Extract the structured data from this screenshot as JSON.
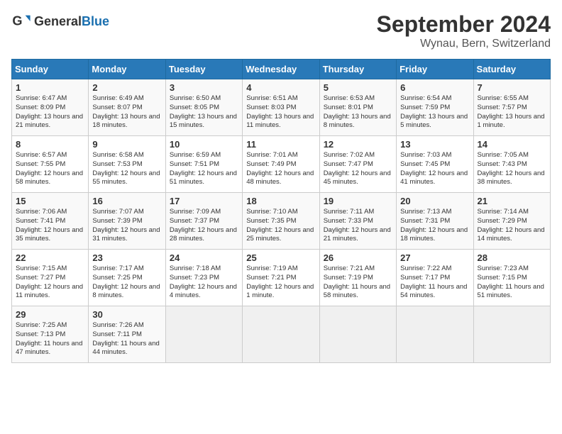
{
  "header": {
    "logo_general": "General",
    "logo_blue": "Blue",
    "title": "September 2024",
    "subtitle": "Wynau, Bern, Switzerland"
  },
  "days_of_week": [
    "Sunday",
    "Monday",
    "Tuesday",
    "Wednesday",
    "Thursday",
    "Friday",
    "Saturday"
  ],
  "weeks": [
    {
      "days": [
        {
          "num": "1",
          "sunrise": "Sunrise: 6:47 AM",
          "sunset": "Sunset: 8:09 PM",
          "daylight": "Daylight: 13 hours and 21 minutes."
        },
        {
          "num": "2",
          "sunrise": "Sunrise: 6:49 AM",
          "sunset": "Sunset: 8:07 PM",
          "daylight": "Daylight: 13 hours and 18 minutes."
        },
        {
          "num": "3",
          "sunrise": "Sunrise: 6:50 AM",
          "sunset": "Sunset: 8:05 PM",
          "daylight": "Daylight: 13 hours and 15 minutes."
        },
        {
          "num": "4",
          "sunrise": "Sunrise: 6:51 AM",
          "sunset": "Sunset: 8:03 PM",
          "daylight": "Daylight: 13 hours and 11 minutes."
        },
        {
          "num": "5",
          "sunrise": "Sunrise: 6:53 AM",
          "sunset": "Sunset: 8:01 PM",
          "daylight": "Daylight: 13 hours and 8 minutes."
        },
        {
          "num": "6",
          "sunrise": "Sunrise: 6:54 AM",
          "sunset": "Sunset: 7:59 PM",
          "daylight": "Daylight: 13 hours and 5 minutes."
        },
        {
          "num": "7",
          "sunrise": "Sunrise: 6:55 AM",
          "sunset": "Sunset: 7:57 PM",
          "daylight": "Daylight: 13 hours and 1 minute."
        }
      ]
    },
    {
      "days": [
        {
          "num": "8",
          "sunrise": "Sunrise: 6:57 AM",
          "sunset": "Sunset: 7:55 PM",
          "daylight": "Daylight: 12 hours and 58 minutes."
        },
        {
          "num": "9",
          "sunrise": "Sunrise: 6:58 AM",
          "sunset": "Sunset: 7:53 PM",
          "daylight": "Daylight: 12 hours and 55 minutes."
        },
        {
          "num": "10",
          "sunrise": "Sunrise: 6:59 AM",
          "sunset": "Sunset: 7:51 PM",
          "daylight": "Daylight: 12 hours and 51 minutes."
        },
        {
          "num": "11",
          "sunrise": "Sunrise: 7:01 AM",
          "sunset": "Sunset: 7:49 PM",
          "daylight": "Daylight: 12 hours and 48 minutes."
        },
        {
          "num": "12",
          "sunrise": "Sunrise: 7:02 AM",
          "sunset": "Sunset: 7:47 PM",
          "daylight": "Daylight: 12 hours and 45 minutes."
        },
        {
          "num": "13",
          "sunrise": "Sunrise: 7:03 AM",
          "sunset": "Sunset: 7:45 PM",
          "daylight": "Daylight: 12 hours and 41 minutes."
        },
        {
          "num": "14",
          "sunrise": "Sunrise: 7:05 AM",
          "sunset": "Sunset: 7:43 PM",
          "daylight": "Daylight: 12 hours and 38 minutes."
        }
      ]
    },
    {
      "days": [
        {
          "num": "15",
          "sunrise": "Sunrise: 7:06 AM",
          "sunset": "Sunset: 7:41 PM",
          "daylight": "Daylight: 12 hours and 35 minutes."
        },
        {
          "num": "16",
          "sunrise": "Sunrise: 7:07 AM",
          "sunset": "Sunset: 7:39 PM",
          "daylight": "Daylight: 12 hours and 31 minutes."
        },
        {
          "num": "17",
          "sunrise": "Sunrise: 7:09 AM",
          "sunset": "Sunset: 7:37 PM",
          "daylight": "Daylight: 12 hours and 28 minutes."
        },
        {
          "num": "18",
          "sunrise": "Sunrise: 7:10 AM",
          "sunset": "Sunset: 7:35 PM",
          "daylight": "Daylight: 12 hours and 25 minutes."
        },
        {
          "num": "19",
          "sunrise": "Sunrise: 7:11 AM",
          "sunset": "Sunset: 7:33 PM",
          "daylight": "Daylight: 12 hours and 21 minutes."
        },
        {
          "num": "20",
          "sunrise": "Sunrise: 7:13 AM",
          "sunset": "Sunset: 7:31 PM",
          "daylight": "Daylight: 12 hours and 18 minutes."
        },
        {
          "num": "21",
          "sunrise": "Sunrise: 7:14 AM",
          "sunset": "Sunset: 7:29 PM",
          "daylight": "Daylight: 12 hours and 14 minutes."
        }
      ]
    },
    {
      "days": [
        {
          "num": "22",
          "sunrise": "Sunrise: 7:15 AM",
          "sunset": "Sunset: 7:27 PM",
          "daylight": "Daylight: 12 hours and 11 minutes."
        },
        {
          "num": "23",
          "sunrise": "Sunrise: 7:17 AM",
          "sunset": "Sunset: 7:25 PM",
          "daylight": "Daylight: 12 hours and 8 minutes."
        },
        {
          "num": "24",
          "sunrise": "Sunrise: 7:18 AM",
          "sunset": "Sunset: 7:23 PM",
          "daylight": "Daylight: 12 hours and 4 minutes."
        },
        {
          "num": "25",
          "sunrise": "Sunrise: 7:19 AM",
          "sunset": "Sunset: 7:21 PM",
          "daylight": "Daylight: 12 hours and 1 minute."
        },
        {
          "num": "26",
          "sunrise": "Sunrise: 7:21 AM",
          "sunset": "Sunset: 7:19 PM",
          "daylight": "Daylight: 11 hours and 58 minutes."
        },
        {
          "num": "27",
          "sunrise": "Sunrise: 7:22 AM",
          "sunset": "Sunset: 7:17 PM",
          "daylight": "Daylight: 11 hours and 54 minutes."
        },
        {
          "num": "28",
          "sunrise": "Sunrise: 7:23 AM",
          "sunset": "Sunset: 7:15 PM",
          "daylight": "Daylight: 11 hours and 51 minutes."
        }
      ]
    },
    {
      "days": [
        {
          "num": "29",
          "sunrise": "Sunrise: 7:25 AM",
          "sunset": "Sunset: 7:13 PM",
          "daylight": "Daylight: 11 hours and 47 minutes."
        },
        {
          "num": "30",
          "sunrise": "Sunrise: 7:26 AM",
          "sunset": "Sunset: 7:11 PM",
          "daylight": "Daylight: 11 hours and 44 minutes."
        },
        {
          "num": "",
          "sunrise": "",
          "sunset": "",
          "daylight": ""
        },
        {
          "num": "",
          "sunrise": "",
          "sunset": "",
          "daylight": ""
        },
        {
          "num": "",
          "sunrise": "",
          "sunset": "",
          "daylight": ""
        },
        {
          "num": "",
          "sunrise": "",
          "sunset": "",
          "daylight": ""
        },
        {
          "num": "",
          "sunrise": "",
          "sunset": "",
          "daylight": ""
        }
      ]
    }
  ]
}
